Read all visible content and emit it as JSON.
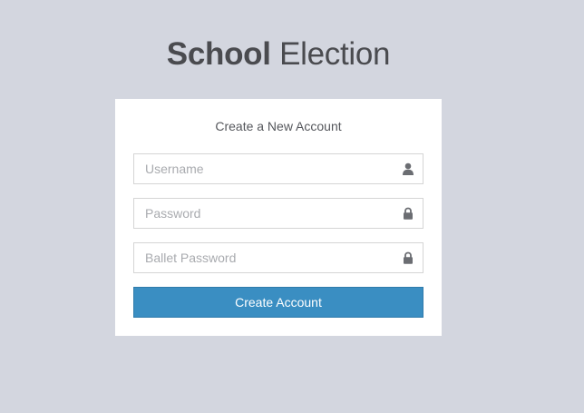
{
  "header": {
    "title_bold": "School",
    "title_light": "Election"
  },
  "form": {
    "heading": "Create a New Account",
    "username": {
      "placeholder": "Username",
      "value": "",
      "icon": "user-icon"
    },
    "password": {
      "placeholder": "Password",
      "value": "",
      "icon": "lock-icon"
    },
    "ballot_password": {
      "placeholder": "Ballet Password",
      "value": "",
      "icon": "lock-icon"
    },
    "submit_label": "Create Account"
  },
  "colors": {
    "background": "#d3d6df",
    "card": "#ffffff",
    "accent": "#3a8ec2",
    "title": "#4a4b4f",
    "icon": "#6b6d72"
  }
}
